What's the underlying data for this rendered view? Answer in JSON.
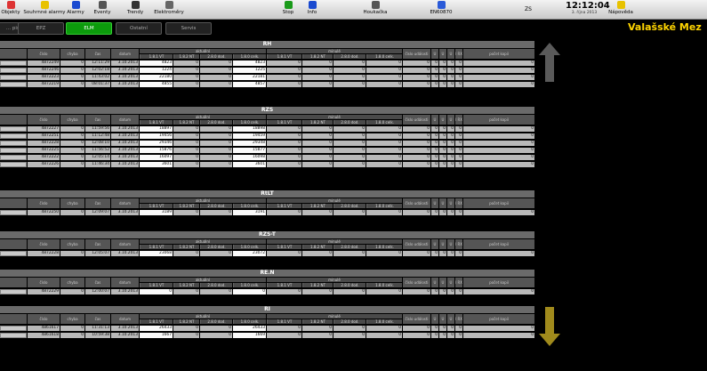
{
  "toolbar": {
    "items": [
      {
        "label": "Objekty",
        "icon": "objects-icon",
        "color": "#d33"
      },
      {
        "label": "Souhrnné alarmy",
        "icon": "summary-alarms-icon",
        "color": "#e8c200"
      },
      {
        "label": "Alarmy",
        "icon": "alarms-icon",
        "color": "#1a4ad0"
      },
      {
        "label": "Eventy",
        "icon": "events-icon",
        "color": "#555"
      },
      {
        "label": "Trendy",
        "icon": "trends-icon",
        "color": "#333"
      },
      {
        "label": "Elektroměry",
        "icon": "electricity-meters-icon",
        "color": "#666"
      },
      {
        "label": "Stop",
        "icon": "stop-icon",
        "color": "#1a9a1a"
      },
      {
        "label": "Info",
        "icon": "info-icon",
        "color": "#1a4ad0"
      },
      {
        "label": "Houkačka",
        "icon": "horn-icon",
        "color": "#555"
      },
      {
        "label": "EN60870",
        "icon": "network-icon",
        "color": "#2a5ad8"
      },
      {
        "label": "Nápověda",
        "icon": "help-icon",
        "color": "#e8c200"
      }
    ],
    "zs": "ZS",
    "time": "12:12:04",
    "date": "3. října 2013"
  },
  "tabs": [
    {
      "label": "... pisy",
      "active": false
    },
    {
      "label": "EPZ",
      "active": false
    },
    {
      "label": "ELM",
      "active": true
    },
    {
      "label": "Ostatní",
      "active": false
    },
    {
      "label": "Servis",
      "active": false
    }
  ],
  "location": "Valašské Mez",
  "columns": {
    "cislo": "číslo",
    "chyba": "chyba",
    "cas": "čas",
    "datum": "datum",
    "aktualni": "aktuální",
    "minule": "minulé",
    "sub": [
      "1.8.1 VT",
      "1.8.2 NT",
      "2.8.0 dod.",
      "1.8.0 celk.",
      "1.8.1 VT",
      "1.8.2 NT",
      "2.8.0 dod.",
      "1.8.0 celk."
    ],
    "cislo_udalosti": "číslo události",
    "flags": [
      "U RX",
      "U RX",
      "U RX",
      "I RX"
    ],
    "pocet_kopii": "počet kopií"
  },
  "sections": [
    {
      "title": "RH",
      "rows": [
        {
          "id": "4872249",
          "err": "0",
          "time": "12:11:29",
          "date": "3.10.2013",
          "v": [
            "4823",
            "0",
            "0",
            "4823",
            "0",
            "0",
            "0",
            "0"
          ],
          "ev": "0",
          "f": [
            "0",
            "0",
            "0",
            "0"
          ],
          "cnt": "0"
        },
        {
          "id": "4872246",
          "err": "0",
          "time": "12:02:18",
          "date": "3.10.2013",
          "v": [
            "1224",
            "0",
            "0",
            "1225",
            "0",
            "0",
            "0",
            "0"
          ],
          "ev": "0",
          "f": [
            "0",
            "0",
            "0",
            "0"
          ],
          "cnt": "0"
        },
        {
          "id": "4872223",
          "err": "0",
          "time": "11:43:02",
          "date": "3.10.2013",
          "v": [
            "22180",
            "0",
            "0",
            "22181",
            "0",
            "0",
            "0",
            "0"
          ],
          "ev": "0",
          "f": [
            "0",
            "0",
            "0",
            "0"
          ],
          "cnt": "0"
        },
        {
          "id": "4872219",
          "err": "0",
          "time": "08:01:37",
          "date": "3.10.2013",
          "v": [
            "4855",
            "0",
            "0",
            "4857",
            "0",
            "0",
            "0",
            "0"
          ],
          "ev": "0",
          "f": [
            "0",
            "0",
            "0",
            "0"
          ],
          "cnt": "0"
        }
      ]
    },
    {
      "title": "RZS",
      "rows": [
        {
          "id": "4872227",
          "err": "0",
          "time": "11:59:56",
          "date": "3.10.2013",
          "v": [
            "18897",
            "0",
            "0",
            "18898",
            "0",
            "0",
            "0",
            "0"
          ],
          "ev": "0",
          "f": [
            "0",
            "0",
            "0",
            "0"
          ],
          "cnt": "0"
        },
        {
          "id": "4872251",
          "err": "0",
          "time": "11:12:48",
          "date": "3.10.2013",
          "v": [
            "19456",
            "0",
            "0",
            "19459",
            "0",
            "0",
            "0",
            "0"
          ],
          "ev": "0",
          "f": [
            "0",
            "0",
            "0",
            "0"
          ],
          "cnt": "0"
        },
        {
          "id": "4872228",
          "err": "0",
          "time": "12:08:10",
          "date": "3.10.2013",
          "v": [
            "29346",
            "0",
            "0",
            "29348",
            "0",
            "0",
            "0",
            "0"
          ],
          "ev": "0",
          "f": [
            "0",
            "0",
            "0",
            "0"
          ],
          "cnt": "0"
        },
        {
          "id": "4872225",
          "err": "0",
          "time": "11:56:52",
          "date": "3.10.2013",
          "v": [
            "15876",
            "0",
            "0",
            "15877",
            "0",
            "0",
            "0",
            "0"
          ],
          "ev": "0",
          "f": [
            "0",
            "0",
            "0",
            "0"
          ],
          "cnt": "0"
        },
        {
          "id": "4872222",
          "err": "0",
          "time": "12:05:14",
          "date": "3.10.2013",
          "v": [
            "16097",
            "0",
            "0",
            "16098",
            "0",
            "0",
            "0",
            "0"
          ],
          "ev": "0",
          "f": [
            "0",
            "0",
            "0",
            "0"
          ],
          "cnt": "0"
        },
        {
          "id": "4872226",
          "err": "0",
          "time": "11:46:34",
          "date": "3.10.2013",
          "v": [
            "3601",
            "0",
            "0",
            "3601",
            "0",
            "0",
            "0",
            "0"
          ],
          "ev": "0",
          "f": [
            "0",
            "0",
            "0",
            "0"
          ],
          "cnt": "0"
        }
      ]
    },
    {
      "title": "RtLT",
      "rows": [
        {
          "id": "4872250",
          "err": "0",
          "time": "12:09:07",
          "date": "3.10.2013",
          "v": [
            "3189",
            "0",
            "0",
            "3191",
            "0",
            "0",
            "0",
            "0"
          ],
          "ev": "0",
          "f": [
            "0",
            "0",
            "0",
            "0"
          ],
          "cnt": "0"
        }
      ]
    },
    {
      "title": "RZS-T",
      "rows": [
        {
          "id": "4872228",
          "err": "0",
          "time": "12:05:07",
          "date": "3.10.2013",
          "v": [
            "23068",
            "0",
            "0",
            "23072",
            "0",
            "0",
            "0",
            "0"
          ],
          "ev": "0",
          "f": [
            "0",
            "0",
            "0",
            "0"
          ],
          "cnt": "0"
        }
      ]
    },
    {
      "title": "RE.N",
      "rows": [
        {
          "id": "4872229",
          "err": "0",
          "time": "12:00:07",
          "date": "3.10.2013",
          "v": [
            "0",
            "0",
            "0",
            "0",
            "0",
            "0",
            "0",
            "0"
          ],
          "ev": "0",
          "f": [
            "0",
            "0",
            "0",
            "0"
          ],
          "cnt": "0"
        }
      ]
    },
    {
      "title": "RI",
      "rows": [
        {
          "id": "4861617",
          "err": "0",
          "time": "11:31:13",
          "date": "3.10.2013",
          "v": [
            "26433",
            "0",
            "0",
            "26433",
            "0",
            "0",
            "0",
            "0"
          ],
          "ev": "0",
          "f": [
            "0",
            "0",
            "0",
            "0"
          ],
          "cnt": "0"
        },
        {
          "id": "4861618",
          "err": "0",
          "time": "10:59:38",
          "date": "3.10.2013",
          "v": [
            "1667",
            "0",
            "0",
            "1669",
            "0",
            "0",
            "0",
            "0"
          ],
          "ev": "0",
          "f": [
            "0",
            "0",
            "0",
            "0"
          ],
          "cnt": "0"
        }
      ]
    }
  ]
}
